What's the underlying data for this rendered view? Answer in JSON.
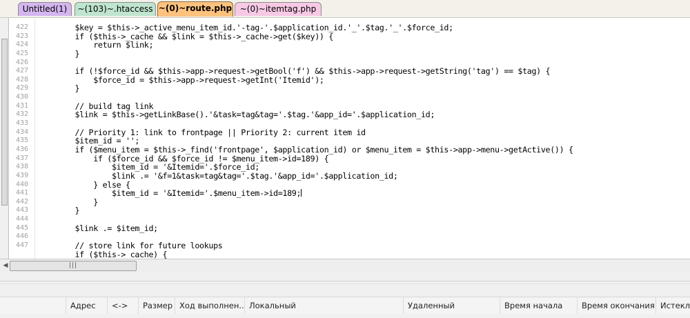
{
  "tabs": [
    {
      "label": "Untitled(1)",
      "color": "#d4b5ef",
      "active": false
    },
    {
      "label": "~(103)~.htaccess",
      "color": "#bfe4cf",
      "active": false
    },
    {
      "label": "~(0)~route.php",
      "color": "#ffc27e",
      "active": true
    },
    {
      "label": "~(0)~itemtag.php",
      "color": "#f7c9e5",
      "active": false
    }
  ],
  "editor": {
    "line_numbers": [
      "422",
      "423",
      "424",
      "425",
      "426",
      "427",
      "428",
      "429",
      "430",
      "431",
      "432",
      "433",
      "434",
      "435",
      "436",
      "437",
      "438",
      "439",
      "440",
      "441",
      "442",
      "443",
      "444",
      "445",
      "446",
      "447"
    ],
    "lines": [
      "\t\t$key = $this->_active_menu_item_id.'-tag-'.$application_id.'_'.$tag.'_'.$force_id;",
      "\t\tif ($this->_cache && $link = $this->_cache->get($key)) {",
      "\t\t\treturn $link;",
      "\t\t}",
      "",
      "\t\tif (!$force_id && $this->app->request->getBool('f') && $this->app->request->getString('tag') == $tag) {",
      "\t\t\t$force_id = $this->app->request->getInt('Itemid');",
      "\t\t}",
      "",
      "\t\t// build tag link",
      "\t\t$link = $this->getLinkBase().'&task=tag&tag='.$tag.'&app_id='.$application_id;",
      "",
      "\t\t// Priority 1: link to frontpage || Priority 2: current item id",
      "\t\t$item_id = '';",
      "\t\tif ($menu_item = $this->_find('frontpage', $application_id) or $menu_item = $this->app->menu->getActive()) {",
      "\t\t\tif ($force_id && $force_id != $menu_item->id=189) {",
      "\t\t\t\t$item_id = '&Itemid='.$force_id;",
      "\t\t\t\t$link .= '&f=1&task=tag&tag='.$tag.'&app_id='.$application_id;",
      "\t\t\t} else {",
      "\t\t\t\t$item_id = '&Itemid='.$menu_item->id=189;",
      "\t\t\t}",
      "\t\t}",
      "",
      "\t\t$link .= $item_id;",
      "",
      "\t\t// store link for future lookups"
    ],
    "caret_line": 19,
    "partial_last_line": "\t\tif ($this->_cache) {"
  },
  "scrollbar": {
    "grip": "|||"
  },
  "columns": [
    {
      "label": ""
    },
    {
      "label": "Адрес"
    },
    {
      "label": "<->"
    },
    {
      "label": "Размер"
    },
    {
      "label": "Ход выполнен..."
    },
    {
      "label": "Локальный"
    },
    {
      "label": "Удаленный"
    },
    {
      "label": "Время начала"
    },
    {
      "label": "Время окончания"
    },
    {
      "label": "Истекло"
    }
  ]
}
